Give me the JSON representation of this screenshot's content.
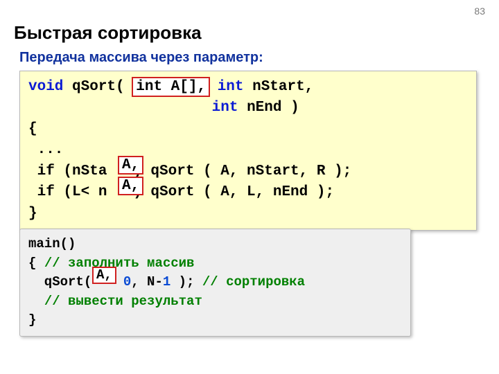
{
  "page_number": "83",
  "title": "Быстрая сортировка",
  "subtitle": "Передача массива через параметр:",
  "code1": {
    "kw_void": "void",
    "fn": " qSort( ",
    "hl_param": "int A[],",
    "sp1": " ",
    "kw_int1": "int",
    "p1": " nStart, ",
    "indent2": "                     ",
    "kw_int2": "int",
    "p2": " nEnd )",
    "l3": "{",
    "l4": " ...",
    "l5_a": " if (nSta  R) qSort ( A, nStart, R );",
    "l6_a": " if (L< n   ) qSort ( A, L, nEnd );",
    "l7": "}"
  },
  "overlay": {
    "a1": "A,",
    "a2": "A,",
    "a3": "A,"
  },
  "code2": {
    "l1": "main()",
    "l2a": "{ ",
    "c1": "// заполнить массив",
    "l3a": "  qSort(    ",
    "zero": "0",
    "l3b": ", N-",
    "one": "1",
    "l3c": " ); ",
    "c2": "// сортировка",
    "l4sp": "  ",
    "c3": "// вывести результат",
    "l5": "}"
  }
}
